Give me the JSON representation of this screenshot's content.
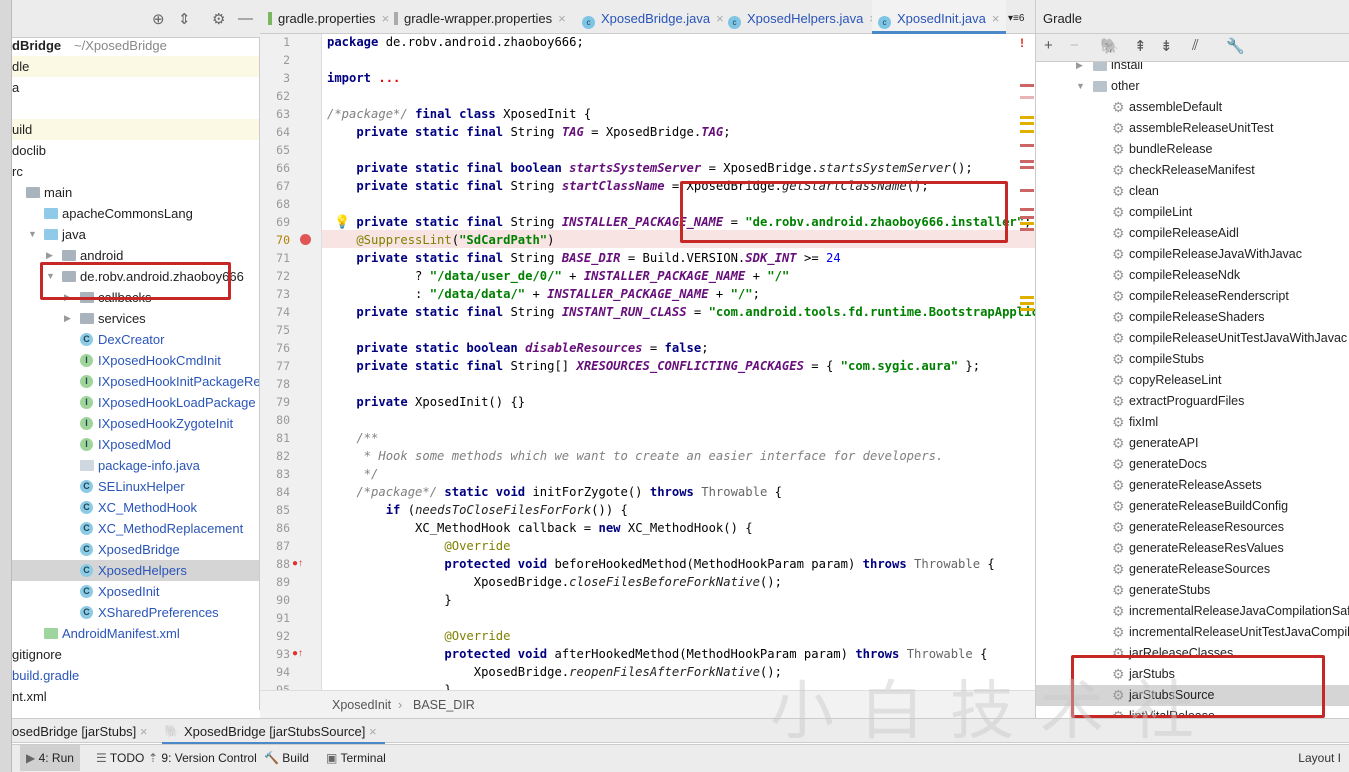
{
  "project_panel": {
    "rows": [
      {
        "label": "dBridge",
        "extra": "~/XposedBridge",
        "bold": true
      },
      {
        "label": "dle",
        "hl": true
      },
      {
        "label": "a"
      },
      {
        "label": ""
      },
      {
        "label": "uild",
        "hl": true
      },
      {
        "label": "doclib"
      },
      {
        "label": "rc"
      },
      {
        "label": "main",
        "icon": "folder",
        "indent": 1
      },
      {
        "label": "apacheCommonsLang",
        "icon": "folder-blue",
        "indent": 2
      },
      {
        "label": "java",
        "icon": "folder-blue",
        "indent": 2,
        "open": true
      },
      {
        "label": "android",
        "icon": "folder",
        "indent": 3,
        "closed": true
      },
      {
        "label": "de.robv.android.zhaoboy666",
        "icon": "folder",
        "indent": 3,
        "open": true
      },
      {
        "label": "callbacks",
        "icon": "folder",
        "indent": 4,
        "closed": true
      },
      {
        "label": "services",
        "icon": "folder",
        "indent": 4,
        "closed": true
      },
      {
        "label": "DexCreator",
        "icon": "class",
        "indent": 4,
        "blue": true
      },
      {
        "label": "IXposedHookCmdInit",
        "icon": "interface",
        "indent": 4,
        "blue": true
      },
      {
        "label": "IXposedHookInitPackageResources",
        "icon": "interface",
        "indent": 4,
        "blue": true
      },
      {
        "label": "IXposedHookLoadPackage",
        "icon": "interface",
        "indent": 4,
        "blue": true
      },
      {
        "label": "IXposedHookZygoteInit",
        "icon": "interface",
        "indent": 4,
        "blue": true
      },
      {
        "label": "IXposedMod",
        "icon": "interface",
        "indent": 4,
        "blue": true
      },
      {
        "label": "package-info.java",
        "icon": "java-file",
        "indent": 4,
        "blue": true
      },
      {
        "label": "SELinuxHelper",
        "icon": "class",
        "indent": 4,
        "blue": true
      },
      {
        "label": "XC_MethodHook",
        "icon": "abstract-class",
        "indent": 4,
        "blue": true
      },
      {
        "label": "XC_MethodReplacement",
        "icon": "abstract-class",
        "indent": 4,
        "blue": true
      },
      {
        "label": "XposedBridge",
        "icon": "class",
        "indent": 4,
        "blue": true
      },
      {
        "label": "XposedHelpers",
        "icon": "class",
        "indent": 4,
        "blue": true,
        "selected": true
      },
      {
        "label": "XposedInit",
        "icon": "class",
        "indent": 4,
        "blue": true
      },
      {
        "label": "XSharedPreferences",
        "icon": "class",
        "indent": 4,
        "blue": true
      },
      {
        "label": "AndroidManifest.xml",
        "icon": "manifest",
        "indent": 2,
        "blue": true
      },
      {
        "label": "gitignore"
      },
      {
        "label": "build.gradle",
        "blue": true
      },
      {
        "label": "nt.xml"
      }
    ]
  },
  "editor_tabs": [
    {
      "label": "gradle.properties",
      "icon": "gradle-file"
    },
    {
      "label": "gradle-wrapper.properties",
      "icon": "properties-file"
    },
    {
      "label": "XposedBridge.java",
      "icon": "class"
    },
    {
      "label": "XposedHelpers.java",
      "icon": "class"
    },
    {
      "label": "XposedInit.java",
      "icon": "class",
      "active": true
    }
  ],
  "tabs_overflow": "6",
  "code": [
    {
      "n": "1",
      "t": [
        [
          "package",
          "k"
        ],
        [
          " de.robv.android.zhaoboy666;",
          "p"
        ]
      ]
    },
    {
      "n": "2",
      "t": []
    },
    {
      "n": "3",
      "t": [
        [
          "import",
          "k"
        ],
        [
          " ",
          "p"
        ],
        [
          "...",
          "r"
        ]
      ]
    },
    {
      "n": "62",
      "t": []
    },
    {
      "n": "63",
      "t": [
        [
          "/*package*/",
          "c"
        ],
        [
          " ",
          "p"
        ],
        [
          "final class",
          "k"
        ],
        [
          " XposedInit {",
          "p"
        ]
      ]
    },
    {
      "n": "64",
      "t": [
        [
          "    private static final",
          "k"
        ],
        [
          " String ",
          "p"
        ],
        [
          "TAG",
          "i"
        ],
        [
          " = XposedBridge.",
          "p"
        ],
        [
          "TAG",
          "i"
        ],
        [
          ";",
          "p"
        ]
      ]
    },
    {
      "n": "65",
      "t": []
    },
    {
      "n": "66",
      "t": [
        [
          "    private static final boolean",
          "k"
        ],
        [
          " ",
          "p"
        ],
        [
          "startsSystemServer",
          "i"
        ],
        [
          " = XposedBridge.",
          "p"
        ],
        [
          "startsSystemServer",
          "m"
        ],
        [
          "();",
          "p"
        ]
      ]
    },
    {
      "n": "67",
      "t": [
        [
          "    private static final",
          "k"
        ],
        [
          " String ",
          "p"
        ],
        [
          "startClassName",
          "i"
        ],
        [
          " = XposedBridge.",
          "p"
        ],
        [
          "getStartClassName",
          "m"
        ],
        [
          "();",
          "p"
        ]
      ]
    },
    {
      "n": "68",
      "t": []
    },
    {
      "n": "69",
      "t": [
        [
          "    private static final",
          "k"
        ],
        [
          " String ",
          "p"
        ],
        [
          "INSTALLER_PACKAGE_NAME",
          "i"
        ],
        [
          " = ",
          "p"
        ],
        [
          "\"de.robv.android.zhaoboy666.installer\"",
          "s"
        ],
        [
          ";",
          "p"
        ]
      ]
    },
    {
      "n": "70",
      "t": [
        [
          "    @SuppressLint",
          "a"
        ],
        [
          "(",
          "p"
        ],
        [
          "\"SdCardPath\"",
          "s"
        ],
        [
          ")",
          "p"
        ]
      ]
    },
    {
      "n": "71",
      "t": [
        [
          "    private static final",
          "k"
        ],
        [
          " String ",
          "p"
        ],
        [
          "BASE_DIR",
          "i"
        ],
        [
          " = Build.VERSION.",
          "p"
        ],
        [
          "SDK_INT",
          "i"
        ],
        [
          " >= ",
          "p"
        ],
        [
          "24",
          "n"
        ]
      ]
    },
    {
      "n": "72",
      "t": [
        [
          "            ? ",
          "p"
        ],
        [
          "\"/data/user_de/0/\"",
          "s"
        ],
        [
          " + ",
          "p"
        ],
        [
          "INSTALLER_PACKAGE_NAME",
          "i"
        ],
        [
          " + ",
          "p"
        ],
        [
          "\"/\"",
          "s"
        ]
      ]
    },
    {
      "n": "73",
      "t": [
        [
          "            : ",
          "p"
        ],
        [
          "\"/data/data/\"",
          "s"
        ],
        [
          " + ",
          "p"
        ],
        [
          "INSTALLER_PACKAGE_NAME",
          "i"
        ],
        [
          " + ",
          "p"
        ],
        [
          "\"/\"",
          "s"
        ],
        [
          ";",
          "p"
        ]
      ]
    },
    {
      "n": "74",
      "t": [
        [
          "    private static final",
          "k"
        ],
        [
          " String ",
          "p"
        ],
        [
          "INSTANT_RUN_CLASS",
          "i"
        ],
        [
          " = ",
          "p"
        ],
        [
          "\"com.android.tools.fd.runtime.BootstrapApplication\"",
          "s"
        ],
        [
          ";",
          "p"
        ]
      ]
    },
    {
      "n": "75",
      "t": []
    },
    {
      "n": "76",
      "t": [
        [
          "    private static boolean",
          "k"
        ],
        [
          " ",
          "p"
        ],
        [
          "disableResources",
          "i"
        ],
        [
          " = ",
          "p"
        ],
        [
          "false",
          "k"
        ],
        [
          ";",
          "p"
        ]
      ]
    },
    {
      "n": "77",
      "t": [
        [
          "    private static final",
          "k"
        ],
        [
          " String[] ",
          "p"
        ],
        [
          "XRESOURCES_CONFLICTING_PACKAGES",
          "i"
        ],
        [
          " = { ",
          "p"
        ],
        [
          "\"com.sygic.aura\"",
          "s"
        ],
        [
          " };",
          "p"
        ]
      ]
    },
    {
      "n": "78",
      "t": []
    },
    {
      "n": "79",
      "t": [
        [
          "    private",
          "k"
        ],
        [
          " XposedInit() {}",
          "p"
        ]
      ]
    },
    {
      "n": "80",
      "t": []
    },
    {
      "n": "81",
      "t": [
        [
          "    /**",
          "c"
        ]
      ]
    },
    {
      "n": "82",
      "t": [
        [
          "     * Hook some methods which we want to create an easier interface for developers.",
          "c"
        ]
      ]
    },
    {
      "n": "83",
      "t": [
        [
          "     */",
          "c"
        ]
      ]
    },
    {
      "n": "84",
      "t": [
        [
          "    /*package*/",
          "c"
        ],
        [
          " ",
          "p"
        ],
        [
          "static void",
          "k"
        ],
        [
          " initForZygote() ",
          "p"
        ],
        [
          "throws",
          "k"
        ],
        [
          " ",
          "p"
        ],
        [
          "Throwable",
          "g"
        ],
        [
          " {",
          "p"
        ]
      ]
    },
    {
      "n": "85",
      "t": [
        [
          "        if",
          "k"
        ],
        [
          " (",
          "p"
        ],
        [
          "needsToCloseFilesForFork",
          "m"
        ],
        [
          "()) {",
          "p"
        ]
      ]
    },
    {
      "n": "86",
      "t": [
        [
          "            XC_MethodHook callback = ",
          "p"
        ],
        [
          "new",
          "k"
        ],
        [
          " XC_MethodHook() {",
          "p"
        ]
      ]
    },
    {
      "n": "87",
      "t": [
        [
          "                @Override",
          "a"
        ]
      ]
    },
    {
      "n": "88",
      "t": [
        [
          "                protected void",
          "k"
        ],
        [
          " beforeHookedMethod(MethodHookParam param) ",
          "p"
        ],
        [
          "throws",
          "k"
        ],
        [
          " ",
          "p"
        ],
        [
          "Throwable",
          "g"
        ],
        [
          " {",
          "p"
        ]
      ]
    },
    {
      "n": "89",
      "t": [
        [
          "                    XposedBridge.",
          "p"
        ],
        [
          "closeFilesBeforeForkNative",
          "m"
        ],
        [
          "();",
          "p"
        ]
      ]
    },
    {
      "n": "90",
      "t": [
        [
          "                }",
          "p"
        ]
      ]
    },
    {
      "n": "91",
      "t": []
    },
    {
      "n": "92",
      "t": [
        [
          "                @Override",
          "a"
        ]
      ]
    },
    {
      "n": "93",
      "t": [
        [
          "                protected void",
          "k"
        ],
        [
          " afterHookedMethod(MethodHookParam param) ",
          "p"
        ],
        [
          "throws",
          "k"
        ],
        [
          " ",
          "p"
        ],
        [
          "Throwable",
          "g"
        ],
        [
          " {",
          "p"
        ]
      ]
    },
    {
      "n": "94",
      "t": [
        [
          "                    XposedBridge.",
          "p"
        ],
        [
          "reopenFilesAfterForkNative",
          "m"
        ],
        [
          "();",
          "p"
        ]
      ]
    },
    {
      "n": "95",
      "t": [
        [
          "                }",
          "p"
        ]
      ]
    }
  ],
  "breadcrumb": [
    "XposedInit",
    "BASE_DIR"
  ],
  "gradle_panel": {
    "title": "Gradle",
    "groups": [
      {
        "label": "install",
        "open": false
      },
      {
        "label": "other",
        "open": true
      }
    ],
    "tasks": [
      "assembleDefault",
      "assembleReleaseUnitTest",
      "bundleRelease",
      "checkReleaseManifest",
      "clean",
      "compileLint",
      "compileReleaseAidl",
      "compileReleaseJavaWithJavac",
      "compileReleaseNdk",
      "compileReleaseRenderscript",
      "compileReleaseShaders",
      "compileReleaseUnitTestJavaWithJavac",
      "compileStubs",
      "copyReleaseLint",
      "extractProguardFiles",
      "fixIml",
      "generateAPI",
      "generateDocs",
      "generateReleaseAssets",
      "generateReleaseBuildConfig",
      "generateReleaseResources",
      "generateReleaseResValues",
      "generateReleaseSources",
      "generateStubs",
      "incrementalReleaseJavaCompilationSafeguard",
      "incrementalReleaseUnitTestJavaCompilationSafeguard",
      "jarReleaseClasses",
      "jarStubs",
      "jarStubsSource",
      "lintVitalRelease"
    ],
    "selected_task": "jarStubsSource"
  },
  "run_tabs": [
    {
      "label": "osedBridge [jarStubs]"
    },
    {
      "label": "XposedBridge [jarStubsSource]",
      "active": true
    }
  ],
  "tool_windows": [
    {
      "label": "4: Run",
      "active": true,
      "icon": "play-icon"
    },
    {
      "label": "TODO",
      "icon": "list-icon"
    },
    {
      "label": "9: Version Control",
      "icon": "vcs-icon"
    },
    {
      "label": "Build",
      "icon": "hammer-icon"
    },
    {
      "label": "Terminal",
      "icon": "terminal-icon"
    }
  ],
  "status_right": "Layout I",
  "watermark": "小白技术社",
  "colors": {
    "annotation_box": "#c62828",
    "accent": "#4a88c7",
    "breakpoint": "#e05555"
  }
}
